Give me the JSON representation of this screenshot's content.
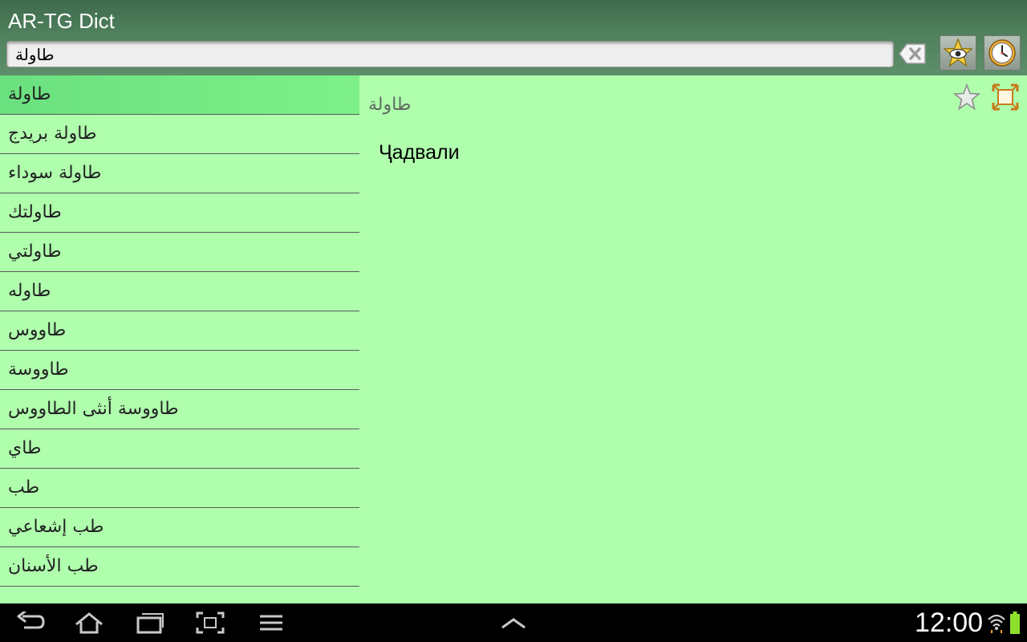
{
  "header": {
    "title": "AR-TG Dict",
    "search_value": "طاولة"
  },
  "word_list": {
    "items": [
      "طاولة",
      "طاولة بريدج",
      "طاولة سوداء",
      "طاولتك",
      "طاولتي",
      "طاوله",
      "طاووس",
      "طاووسة",
      "طاووسة أنثى الطاووس",
      "طاي",
      "طب",
      "طب إشعاعي",
      "طب الأسنان"
    ],
    "selected_index": 0
  },
  "detail": {
    "headword": "طاولة",
    "translation": "Ҷадвали"
  },
  "status_bar": {
    "time": "12:00"
  },
  "icons": {
    "clear": "clear-text-icon",
    "favorites": "star-eye-icon",
    "history": "clock-icon",
    "add_favorite": "star-outline-icon",
    "fullscreen": "fullscreen-icon"
  },
  "colors": {
    "header_top": "#3e6b4c",
    "pane_background": "#afffad",
    "selected_row": "#74e985"
  }
}
